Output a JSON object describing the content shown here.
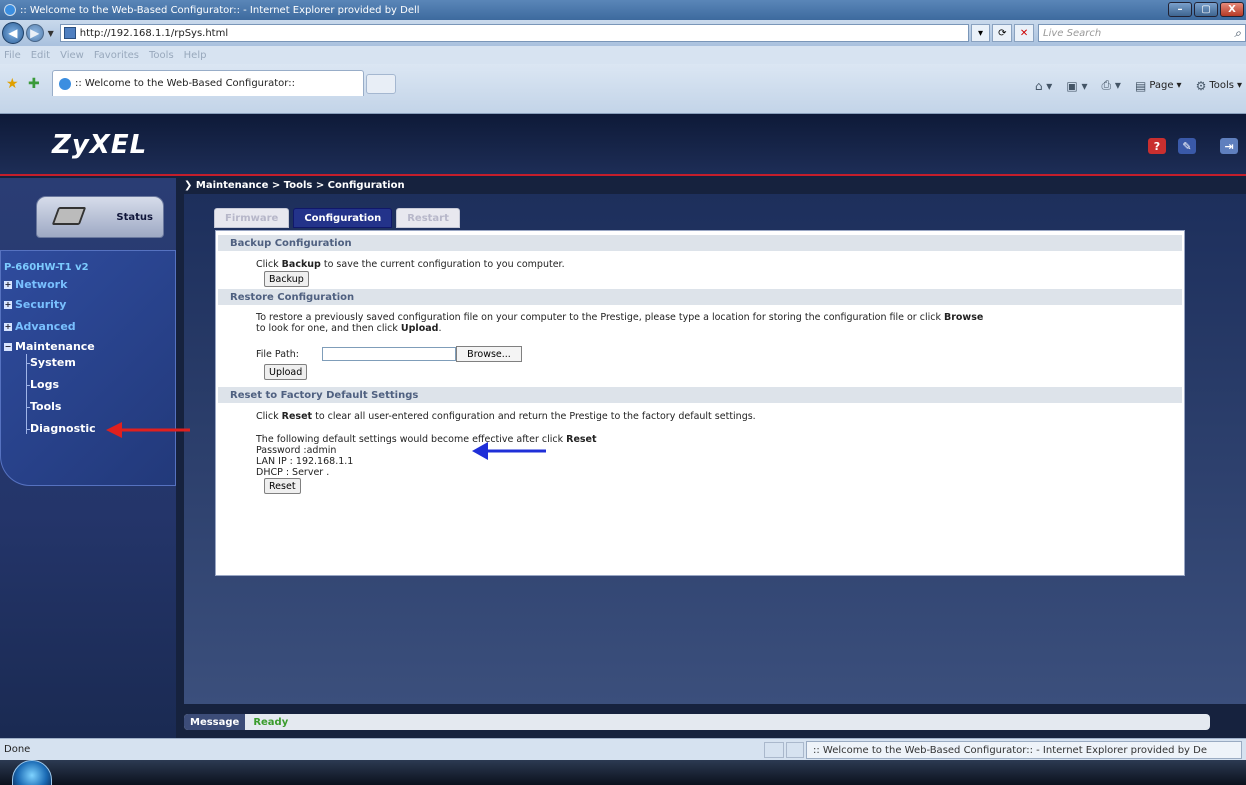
{
  "browser": {
    "title": ":: Welcome to the Web-Based Configurator:: - Internet Explorer provided by Dell",
    "url": "http://192.168.1.1/rpSys.html",
    "search_placeholder": "Live Search",
    "menu": [
      "File",
      "Edit",
      "View",
      "Favorites",
      "Tools",
      "Help"
    ],
    "tab_label": ":: Welcome to the Web-Based Configurator::",
    "cmd_page": "Page",
    "cmd_tools": "Tools",
    "status": "Done",
    "taskbar_item": ":: Welcome to the Web-Based Configurator:: - Internet Explorer provided by De"
  },
  "app": {
    "logo": "ZyXEL",
    "status_label": "Status",
    "device": "P-660HW-T1 v2",
    "menu": {
      "network": "Network",
      "security": "Security",
      "advanced": "Advanced",
      "maintenance": "Maintenance",
      "system": "System",
      "logs": "Logs",
      "tools": "Tools",
      "diagnostic": "Diagnostic"
    },
    "breadcrumb": "Maintenance > Tools > Configuration",
    "tabs": {
      "firmware": "Firmware",
      "configuration": "Configuration",
      "restart": "Restart"
    },
    "backup": {
      "heading": "Backup Configuration",
      "text_pre": "Click ",
      "text_bold": "Backup",
      "text_post": " to save the current configuration to you computer.",
      "button": "Backup"
    },
    "restore": {
      "heading": "Restore Configuration",
      "line1_pre": "To restore a previously saved configuration file on your computer to the Prestige, please type a location for storing the configuration file or click ",
      "line1_bold": "Browse",
      "line2_pre": "to look for one, and then click ",
      "line2_bold": "Upload",
      "line2_post": ".",
      "file_label": "File Path:",
      "browse_button": "Browse...",
      "upload_button": "Upload"
    },
    "reset": {
      "heading": "Reset to Factory Default Settings",
      "text_pre": "Click ",
      "text_bold": "Reset",
      "text_post": " to clear all user-entered configuration and return the Prestige to the factory default settings.",
      "defaults_pre": "The following default settings would become effective after click ",
      "defaults_bold": "Reset",
      "password": "Password :admin",
      "lan_ip": "LAN IP : 192.168.1.1",
      "dhcp": "DHCP : Server .",
      "button": "Reset"
    },
    "message_label": "Message",
    "message_value": "Ready"
  },
  "colors": {
    "accent_red": "#c41e2b",
    "annotation_red": "#e0201e",
    "annotation_blue": "#1f2fd8",
    "ready_green": "#3a9c2c"
  }
}
